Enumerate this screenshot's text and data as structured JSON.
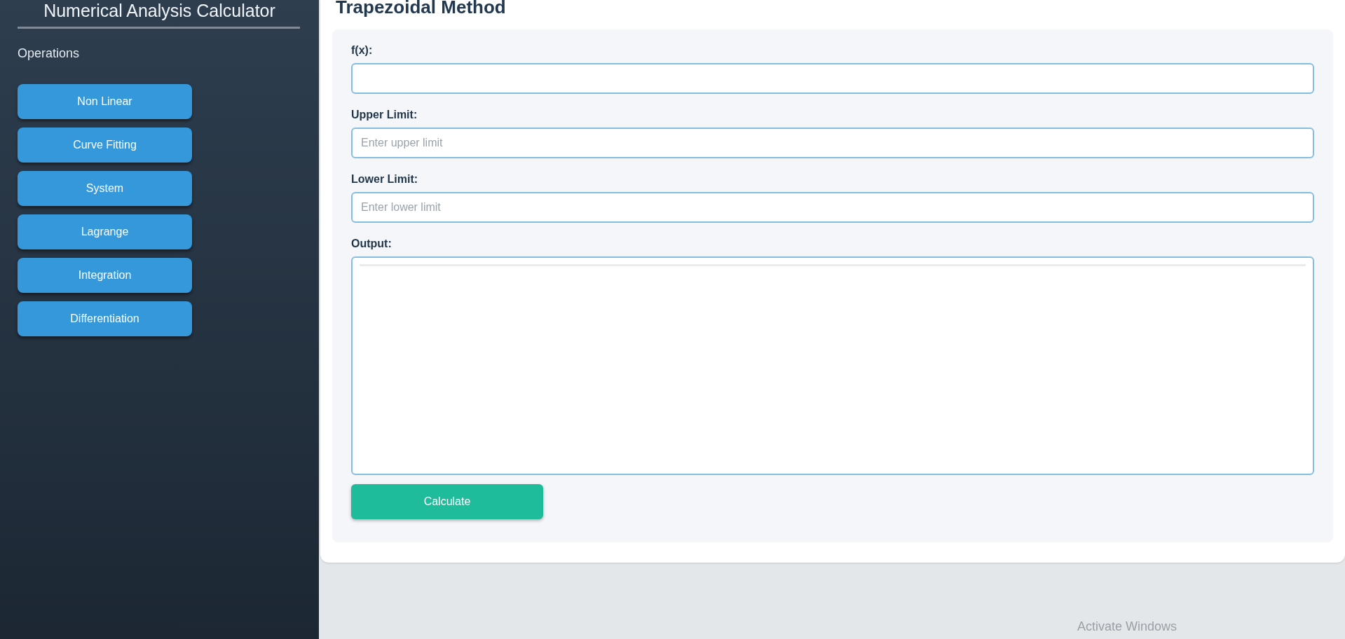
{
  "sidebar": {
    "title": "Numerical Analysis Calculator",
    "section": "Operations",
    "items": [
      {
        "label": "Non Linear"
      },
      {
        "label": "Curve Fitting"
      },
      {
        "label": "System"
      },
      {
        "label": "Lagrange"
      },
      {
        "label": "Integration"
      },
      {
        "label": "Differentiation"
      }
    ]
  },
  "main": {
    "title": "Trapezoidal Method",
    "fields": [
      {
        "label": "f(x):"
      },
      {
        "label": "Upper Limit:",
        "placeholder": "Enter upper limit"
      },
      {
        "label": "Lower Limit:",
        "placeholder": "Enter lower limit"
      }
    ],
    "output": {
      "label": "Output:"
    },
    "button": "Calculate"
  },
  "system_notice": "Activate Windows"
}
